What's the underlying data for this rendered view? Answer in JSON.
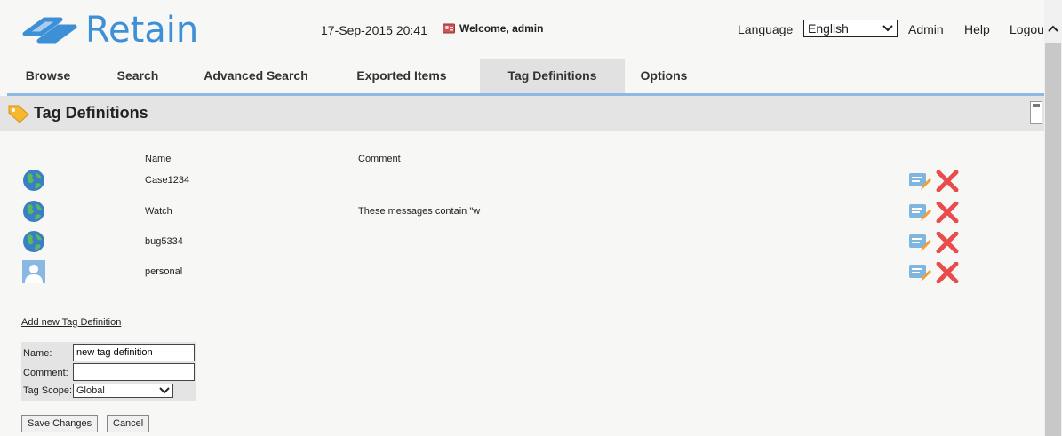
{
  "header": {
    "logo_text": "Retain",
    "datetime": "17-Sep-2015 20:41",
    "welcome": "Welcome, admin",
    "language_label": "Language",
    "language_value": "English",
    "admin_link": "Admin",
    "help_link": "Help",
    "logout_link": "Logout"
  },
  "nav": {
    "tabs": [
      {
        "label": "Browse"
      },
      {
        "label": "Search"
      },
      {
        "label": "Advanced Search"
      },
      {
        "label": "Exported Items"
      },
      {
        "label": "Tag Definitions",
        "active": true
      },
      {
        "label": "Options"
      }
    ]
  },
  "section": {
    "title": "Tag Definitions"
  },
  "table": {
    "headers": {
      "name": "Name",
      "comment": "Comment"
    },
    "rows": [
      {
        "scope_icon": "globe-icon",
        "name": "Case1234",
        "comment": ""
      },
      {
        "scope_icon": "globe-icon",
        "name": "Watch",
        "comment": "These messages contain \"w"
      },
      {
        "scope_icon": "globe-icon",
        "name": "bug5334",
        "comment": ""
      },
      {
        "scope_icon": "person-icon",
        "name": "personal",
        "comment": ""
      }
    ]
  },
  "add_form": {
    "link": "Add new Tag Definition",
    "name_label": "Name:",
    "name_value": "new tag definition",
    "comment_label": "Comment:",
    "comment_value": "",
    "scope_label": "Tag Scope:",
    "scope_value": "Global",
    "save_label": "Save Changes",
    "cancel_label": "Cancel"
  },
  "colors": {
    "accent": "#3d8fd6",
    "nav_line": "#8fb8e3",
    "delete_red": "#e84c4c",
    "edit_blue": "#7fb6e0"
  }
}
